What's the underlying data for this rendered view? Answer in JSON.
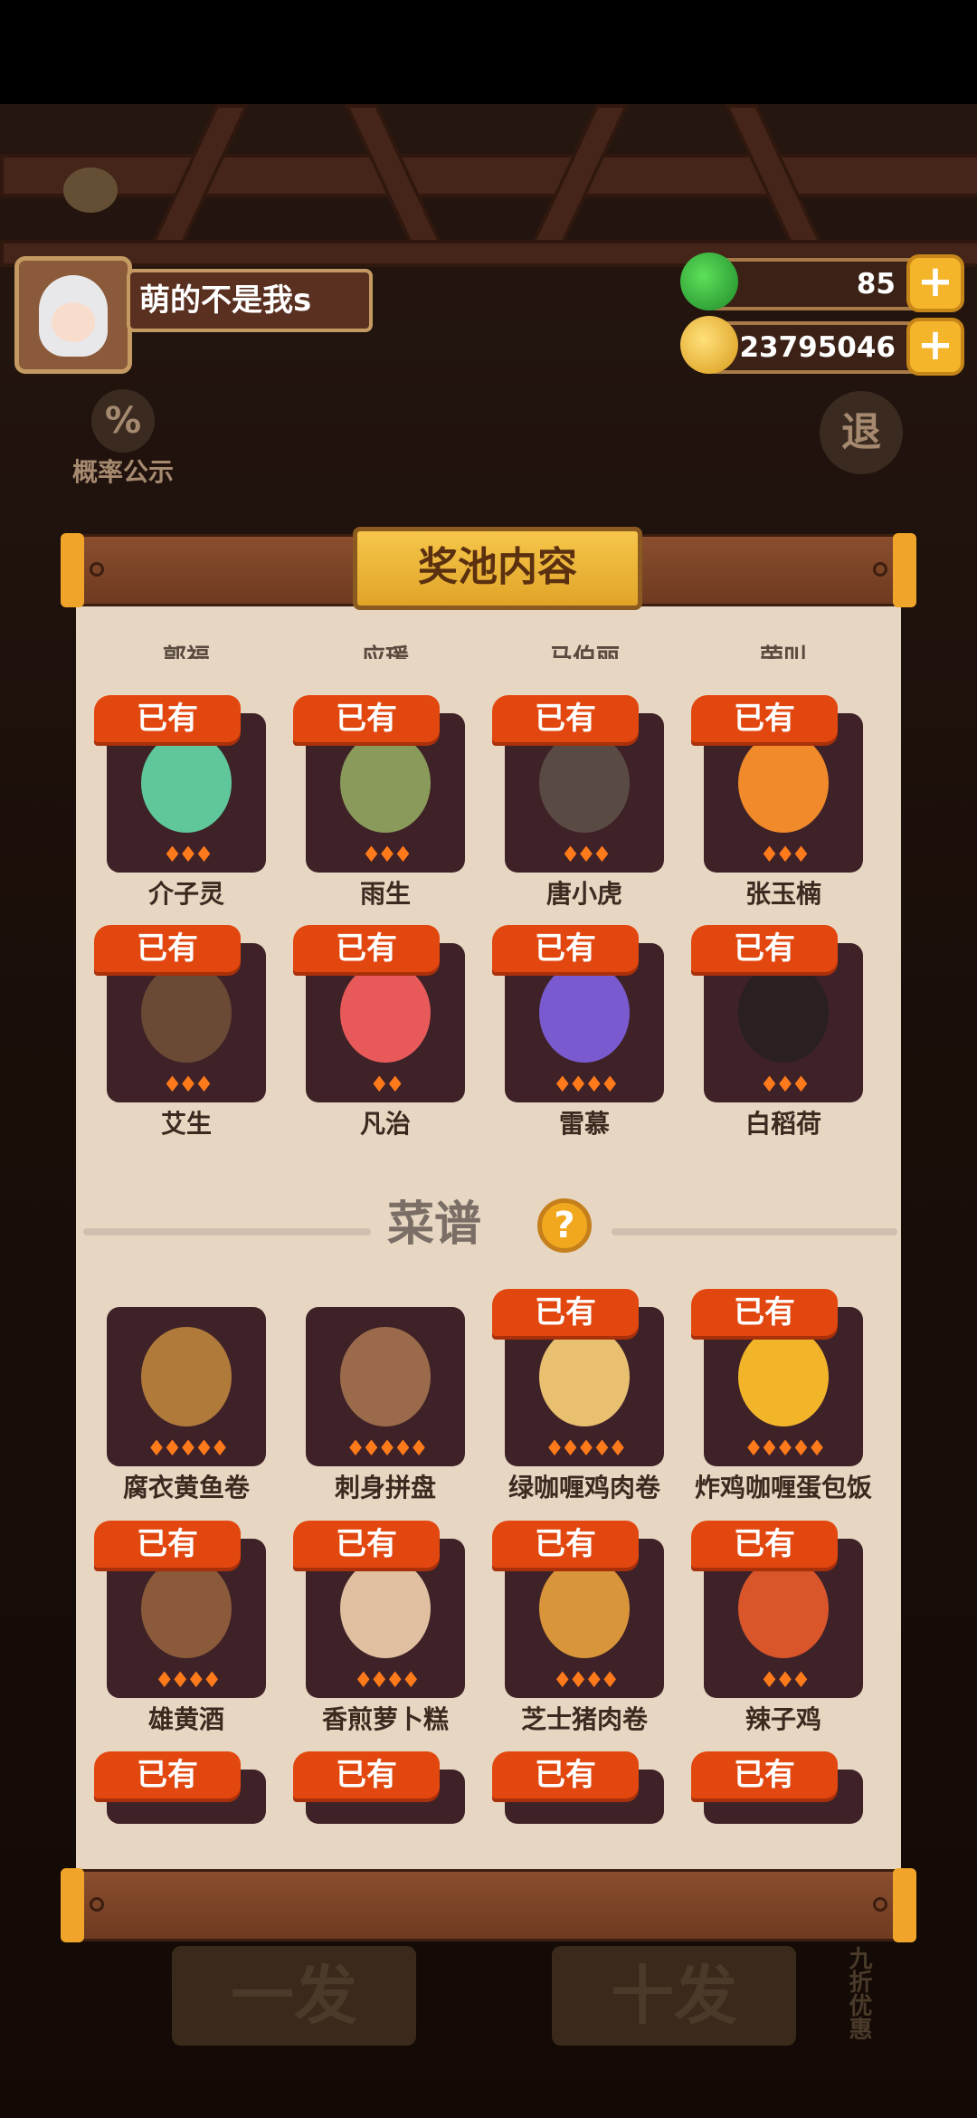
{
  "player": {
    "name": "萌的不是我s"
  },
  "resources": {
    "gems": "85",
    "coins": "23795046"
  },
  "side": {
    "probability_label": "概率公示",
    "percent_symbol": "%",
    "exit_label": "退"
  },
  "panel": {
    "title": "奖池内容",
    "top_cut_labels": [
      "郭福",
      "应瑗",
      "马伯丽",
      "荣叫"
    ],
    "characters": [
      {
        "name": "介子灵",
        "owned": "已有",
        "stars": "♦♦♦",
        "color": "#5fc79a"
      },
      {
        "name": "雨生",
        "owned": "已有",
        "stars": "♦♦♦",
        "color": "#8a9a5a"
      },
      {
        "name": "唐小虎",
        "owned": "已有",
        "stars": "♦♦♦",
        "color": "#5a4a44"
      },
      {
        "name": "张玉楠",
        "owned": "已有",
        "stars": "♦♦♦",
        "color": "#f08a2a"
      },
      {
        "name": "艾生",
        "owned": "已有",
        "stars": "♦♦♦",
        "color": "#6a4a34"
      },
      {
        "name": "凡治",
        "owned": "已有",
        "stars": "♦♦",
        "color": "#e85a5a"
      },
      {
        "name": "雷慕",
        "owned": "已有",
        "stars": "♦♦♦♦",
        "color": "#7a5acf"
      },
      {
        "name": "白稻荷",
        "owned": "已有",
        "stars": "♦♦♦",
        "color": "#2a2020"
      }
    ],
    "recipe_section": {
      "title": "菜谱",
      "help": "?"
    },
    "recipes": [
      {
        "name": "腐衣黄鱼卷",
        "owned": "",
        "stars": "♦♦♦♦♦",
        "color": "#b07a3a"
      },
      {
        "name": "刺身拼盘",
        "owned": "",
        "stars": "♦♦♦♦♦",
        "color": "#9a6a4a"
      },
      {
        "name": "绿咖喱鸡肉卷",
        "owned": "已有",
        "stars": "♦♦♦♦♦",
        "color": "#e8c070"
      },
      {
        "name": "炸鸡咖喱蛋包饭",
        "owned": "已有",
        "stars": "♦♦♦♦♦",
        "color": "#f2b52a"
      },
      {
        "name": "雄黄酒",
        "owned": "已有",
        "stars": "♦♦♦♦",
        "color": "#8a5a3a"
      },
      {
        "name": "香煎萝卜糕",
        "owned": "已有",
        "stars": "♦♦♦♦",
        "color": "#e0c0a0"
      },
      {
        "name": "芝士猪肉卷",
        "owned": "已有",
        "stars": "♦♦♦♦",
        "color": "#d9953a"
      },
      {
        "name": "辣子鸡",
        "owned": "已有",
        "stars": "♦♦♦",
        "color": "#d9552a"
      }
    ],
    "bottom_row_owned": [
      "已有",
      "已有",
      "已有",
      "已有"
    ]
  },
  "bottom_buttons": {
    "single": "一发",
    "ten": "十发",
    "discount": "九折优惠"
  }
}
